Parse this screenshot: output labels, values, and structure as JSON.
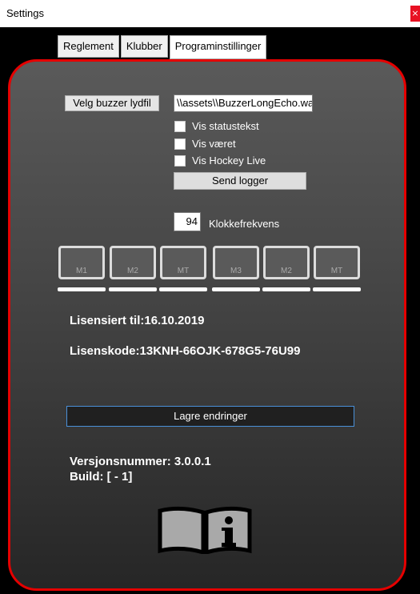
{
  "window": {
    "title": "Settings",
    "close_glyph": "×"
  },
  "tabs": [
    {
      "label": "Reglement",
      "active": false
    },
    {
      "label": "Klubber",
      "active": false
    },
    {
      "label": "Programinstillinger",
      "active": true
    }
  ],
  "buzzer": {
    "button_label": "Velg buzzer lydfil",
    "file_path": "\\\\assets\\\\BuzzerLongEcho.wav"
  },
  "checkboxes": [
    {
      "label": "Vis statustekst",
      "checked": false
    },
    {
      "label": "Vis været",
      "checked": false
    },
    {
      "label": "Vis Hockey Live",
      "checked": false
    }
  ],
  "send_logs_label": "Send logger",
  "clock": {
    "value": "94",
    "label": "Klokkefrekvens"
  },
  "mode_buttons": [
    "M1",
    "M2",
    "MT",
    "M3",
    "M2",
    "MT"
  ],
  "license": {
    "valid_until": "Lisensiert til:16.10.2019",
    "code": "Lisenskode:13KNH-66OJK-678G5-76U99"
  },
  "save_label": "Lagre endringer",
  "version": {
    "number": "Versjonsnummer: 3.0.0.1",
    "build": "Build: [ - 1]"
  },
  "icons": {
    "info": "book-info-icon"
  },
  "colors": {
    "border": "#e50000",
    "panel_top": "#5a5a5a",
    "panel_bottom": "#262626"
  }
}
